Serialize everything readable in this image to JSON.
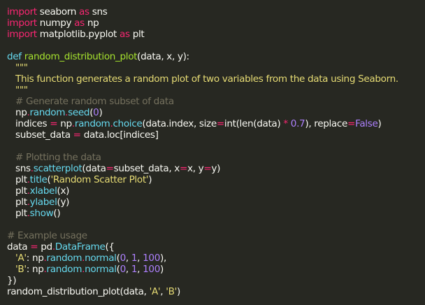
{
  "editor": {
    "background": "#272822",
    "syntax_colors": {
      "keyword": "#f92672",
      "definition": "#66d9ef",
      "function_name": "#a6e22e",
      "string": "#e6db74",
      "number": "#ae81ff",
      "comment": "#75715e",
      "text": "#f8f8f2"
    },
    "tokens": {
      "import": "import",
      "as": "as",
      "def": "def",
      "seaborn": "seaborn",
      "sns": "sns",
      "numpy": "numpy",
      "np": "np",
      "matplotlib": "matplotlib.pyplot",
      "plt": "plt",
      "fn_name": "random_distribution_plot",
      "fn_params": "(data, x, y):",
      "doc_quote": "\"\"\"",
      "doc_text": "This function generates a random plot of two variables from the data using Seaborn.",
      "cmt_subset": "# Generate random subset of data",
      "np_random_seed_a": "np",
      "random": "random",
      "seed": "seed",
      "zero": "0",
      "indices": "indices",
      "choice": "choice",
      "data_index": "data.index, size",
      "int_len": "int(len(data) ",
      "star": "*",
      "point7": "0.7",
      "replace": "), replace",
      "false": "False",
      "close_paren": ")",
      "subset_data": "subset_data",
      "data_loc": "data.loc[indices]",
      "cmt_plot": "# Plotting the data",
      "scatterplot": "scatterplot",
      "scatter_args_a": "(data",
      "scatter_args_b": "subset_data, x",
      "scatter_args_c": "x, y",
      "scatter_args_d": "y)",
      "title": "title",
      "title_str": "'Random Scatter Plot'",
      "xlabel": "xlabel",
      "xlabel_arg": "(x)",
      "ylabel": "ylabel",
      "ylabel_arg": "(y)",
      "show": "show",
      "show_arg": "()",
      "cmt_example": "# Example usage",
      "data": "data",
      "pd": "pd",
      "dataframe": "DataFrame",
      "open_brace": "({",
      "key_a": "'A'",
      "key_b": "'B'",
      "normal": "normal",
      "one": "1",
      "hundred": "100",
      "line_end_comma": "),",
      "close_brace": "})",
      "call_name": "random_distribution_plot",
      "call_open": "(data, ",
      "comma_space": ", "
    }
  }
}
